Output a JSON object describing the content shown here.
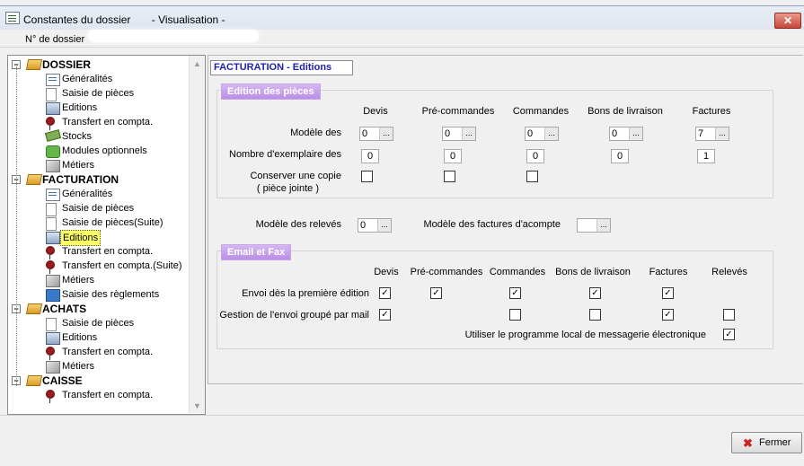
{
  "window": {
    "title": "Constantes du dossier",
    "subtitle": "- Visualisation -",
    "close": "✕"
  },
  "dossier": {
    "label": "N° de dossier"
  },
  "tree": {
    "scroll_up": "▲",
    "scroll_down": "▼",
    "groups": [
      {
        "label": "DOSSIER",
        "items": [
          "Généralités",
          "Saisie de pièces",
          "Editions",
          "Transfert en compta.",
          "Stocks",
          "Modules optionnels",
          "Métiers"
        ]
      },
      {
        "label": "FACTURATION",
        "items": [
          "Généralités",
          "Saisie de pièces",
          "Saisie de pièces(Suite)",
          "Editions",
          "Transfert en compta.",
          "Transfert en compta.(Suite)",
          "Métiers",
          "Saisie des règlements"
        ]
      },
      {
        "label": "ACHATS",
        "items": [
          "Saisie de pièces",
          "Editions",
          "Transfert en compta.",
          "Métiers"
        ]
      },
      {
        "label": "CAISSE",
        "items": [
          "Transfert en compta."
        ]
      }
    ],
    "selected": "FACTURATION / Editions"
  },
  "panel": {
    "header": "FACTURATION - Editions",
    "editions": {
      "legend": "Edition des pièces",
      "columns": [
        "Devis",
        "Pré-commandes",
        "Commandes",
        "Bons de livraison",
        "Factures"
      ],
      "modele_label": "Modèle des",
      "modele_values": [
        "0",
        "0",
        "0",
        "0",
        "7"
      ],
      "exemplaire_label": "Nombre d'exemplaire  des",
      "exemplaire_values": [
        "0",
        "0",
        "0",
        "0",
        "1"
      ],
      "copie_label_1": "Conserver une copie",
      "copie_label_2": "( pièce jointe )",
      "copie_checked": [
        false,
        false,
        false
      ]
    },
    "btn_dots": "...",
    "releves": {
      "label": "Modèle des relevés",
      "value": "0"
    },
    "acompte": {
      "label": "Modèle des factures d'acompte",
      "value": ""
    },
    "email": {
      "legend": "Email et Fax",
      "columns": [
        "Devis",
        "Pré-commandes",
        "Commandes",
        "Bons de livraison",
        "Factures",
        "Relevés"
      ],
      "envoi_label": "Envoi dès la première édition",
      "envoi_checked": [
        true,
        true,
        true,
        true,
        true
      ],
      "groupe_label": "Gestion de l'envoi groupé par mail",
      "groupe_checked": [
        true,
        false,
        false,
        true,
        false
      ],
      "local_label": "Utiliser le programme local de messagerie électronique",
      "local_checked": true
    }
  },
  "footer": {
    "fermer": "Fermer",
    "fermer_icon": "✖"
  }
}
